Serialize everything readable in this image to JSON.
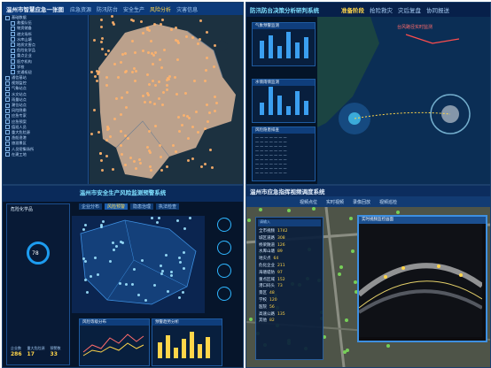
{
  "panel1": {
    "title": "温州市智慧应急一张图",
    "tabs": [
      {
        "label": "应急资源"
      },
      {
        "label": "防汛防台"
      },
      {
        "label": "安全生产"
      },
      {
        "label": "风险分析"
      },
      {
        "label": "灾害信息"
      }
    ],
    "tree_rows": [
      {
        "label": "基础数据",
        "sub": false
      },
      {
        "label": "救援队伍",
        "sub": true
      },
      {
        "label": "物资储备",
        "sub": true
      },
      {
        "label": "避灾场所",
        "sub": true
      },
      {
        "label": "水库山塘",
        "sub": true
      },
      {
        "label": "地质灾害点",
        "sub": true
      },
      {
        "label": "危险化学品",
        "sub": true
      },
      {
        "label": "重点企业",
        "sub": true
      },
      {
        "label": "医疗机构",
        "sub": true
      },
      {
        "label": "学校",
        "sub": true
      },
      {
        "label": "交通枢纽",
        "sub": true
      },
      {
        "label": "通信基站",
        "sub": false
      },
      {
        "label": "视频监控",
        "sub": false
      },
      {
        "label": "气象站点",
        "sub": false
      },
      {
        "label": "水文站点",
        "sub": false
      },
      {
        "label": "雨量站点",
        "sub": false
      },
      {
        "label": "潮位站点",
        "sub": false
      },
      {
        "label": "风险隐患",
        "sub": false
      },
      {
        "label": "应急专家",
        "sub": false
      },
      {
        "label": "应急预案",
        "sub": false
      },
      {
        "label": "值班人员",
        "sub": false
      },
      {
        "label": "重大危险源",
        "sub": false
      },
      {
        "label": "渔船渔港",
        "sub": false
      },
      {
        "label": "旅游景区",
        "sub": false
      },
      {
        "label": "人员密集场所",
        "sub": false
      },
      {
        "label": "在建工地",
        "sub": false
      }
    ]
  },
  "panel2": {
    "title": "防汛防台决策分析研判系统",
    "tabs": [
      {
        "label": "准备阶段",
        "active": true
      },
      {
        "label": "抢险救灾",
        "active": false
      },
      {
        "label": "灾后复盘",
        "active": false
      },
      {
        "label": "协同报送",
        "active": false
      }
    ],
    "cards": [
      {
        "title": "气象预警监测"
      },
      {
        "title": "水情雨情监测"
      },
      {
        "title": "风险隐患排查"
      }
    ],
    "banner": "台风路径实时监测"
  },
  "panel3": {
    "title": "温州市安全生产风险监测预警系统",
    "tabs": [
      {
        "label": "企业分布",
        "active": false
      },
      {
        "label": "风险预警",
        "active": true
      },
      {
        "label": "隐患治理",
        "active": false
      },
      {
        "label": "执法检查",
        "active": false
      }
    ],
    "left_header": "危险化学品",
    "stats": [
      {
        "label": "企业数",
        "value": "286"
      },
      {
        "label": "重大危险源",
        "value": "17"
      },
      {
        "label": "预警数",
        "value": "33"
      }
    ],
    "bottom_labels": [
      "风险等级分布",
      "预警趋势分析"
    ],
    "gauge_value": "78"
  },
  "panel4": {
    "title": "温州市应急指挥视频调度系统",
    "toolbar": [
      "视频点位",
      "实时视频",
      "录像回放",
      "视频巡检"
    ],
    "search_placeholder": "请输入",
    "tree": [
      {
        "label": "全市视频",
        "count": "1742"
      },
      {
        "label": "城区道路",
        "count": "308"
      },
      {
        "label": "桥梁隧道",
        "count": "126"
      },
      {
        "label": "水库山塘",
        "count": "89"
      },
      {
        "label": "地灾点",
        "count": "64"
      },
      {
        "label": "危化企业",
        "count": "211"
      },
      {
        "label": "海塘堤防",
        "count": "97"
      },
      {
        "label": "重点区域",
        "count": "152"
      },
      {
        "label": "港口码头",
        "count": "73"
      },
      {
        "label": "景区",
        "count": "48"
      },
      {
        "label": "学校",
        "count": "120"
      },
      {
        "label": "医院",
        "count": "56"
      },
      {
        "label": "高速公路",
        "count": "135"
      },
      {
        "label": "其他",
        "count": "82"
      }
    ],
    "video_title": "实时视频监控画面"
  }
}
